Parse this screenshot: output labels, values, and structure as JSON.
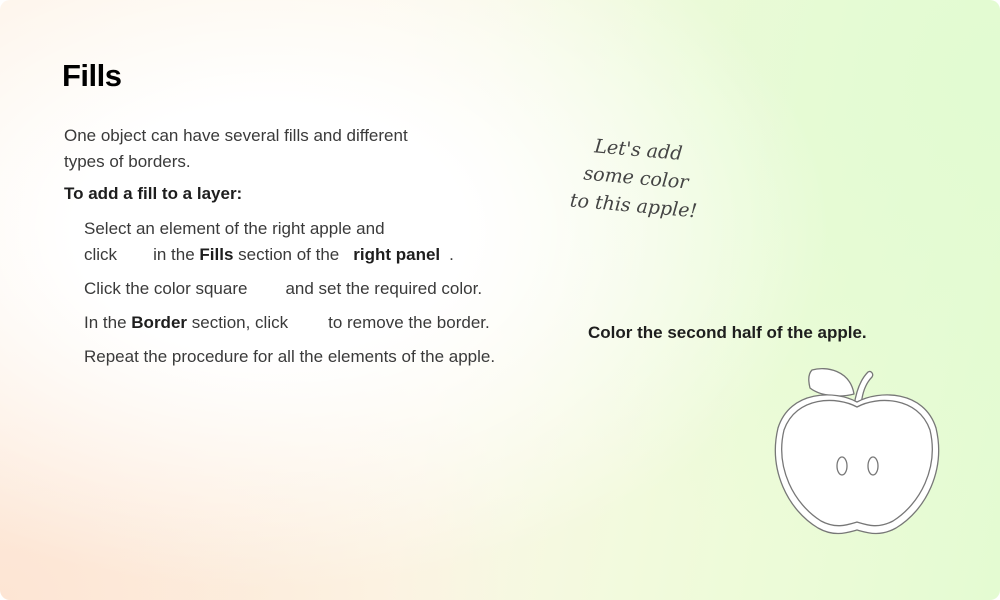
{
  "title": "Fills",
  "intro": {
    "line1": "One object can have several fills and different",
    "line2": "types of borders."
  },
  "howto_heading": "To add a fill to a layer:",
  "steps": {
    "s1": {
      "line1": "Select an element of the right apple and",
      "click": "click",
      "in_the": "in the",
      "fills": "Fills",
      "section_of": "section of the",
      "right_panel": "right panel",
      "dot": "."
    },
    "s2": {
      "before": "Click the color square",
      "after": "and set the required color."
    },
    "s3": {
      "in_the": "In the",
      "border": "Border",
      "section_click": "section, click",
      "after": "to remove the border."
    },
    "s4": "Repeat the procedure for all the elements of the apple."
  },
  "handnote": {
    "line1": "Let's add",
    "line2": "some color",
    "line3": "to this apple!"
  },
  "task": "Color the second half of the apple.",
  "colors": {
    "apple_stroke": "#777777",
    "text": "#3a3a3a",
    "heading": "#000000"
  }
}
